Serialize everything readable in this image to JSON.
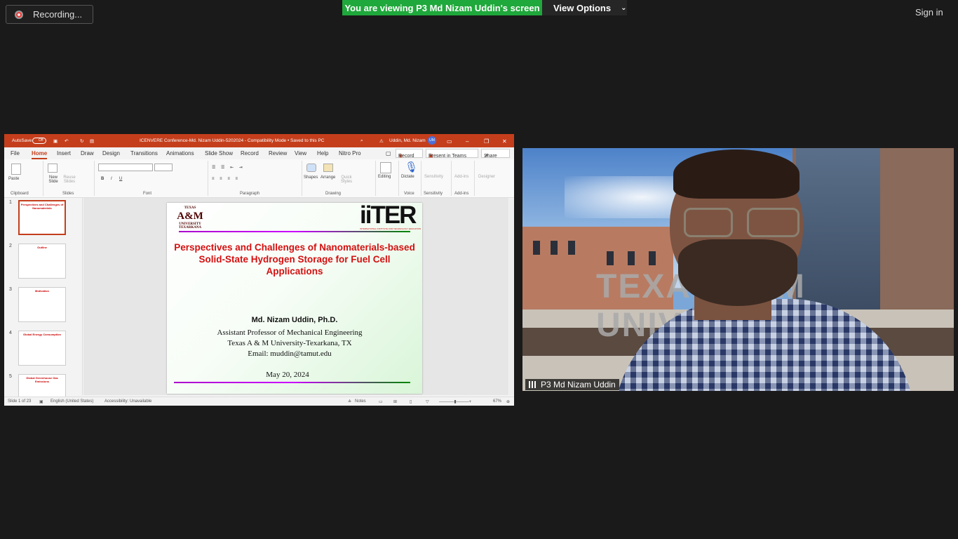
{
  "zoom": {
    "recording_label": "Recording...",
    "viewing_banner": "You are viewing P3 Md Nizam Uddin's screen",
    "view_options": "View Options",
    "sign_in": "Sign in",
    "participant_name": "P3 Md Nizam Uddin",
    "accent_green": "#1fa83b"
  },
  "ppt": {
    "autosave": "AutoSave",
    "autosave_state": "Off",
    "title": "ICENVERE Conference-Md. Nizam Uddin-5202024 - Compatibility Mode • Saved to this PC",
    "user": "Uddin, Md. Nizam",
    "user_initials": "UM",
    "menu": [
      "File",
      "Home",
      "Insert",
      "Draw",
      "Design",
      "Transitions",
      "Animations",
      "Slide Show",
      "Record",
      "Review",
      "View",
      "Help",
      "Nitro Pro"
    ],
    "record_btn": "Record",
    "present_btn": "Present in Teams",
    "share_btn": "Share",
    "ribbon": {
      "paste": "Paste",
      "new_slide": "New Slide",
      "reuse_slides": "Reuse Slides",
      "shapes": "Shapes",
      "arrange": "Arrange",
      "quick_styles": "Quick Styles",
      "editing": "Editing",
      "dictate": "Dictate",
      "sensitivity": "Sensitivity",
      "addins": "Add-ins",
      "designer": "Designer",
      "groups": [
        "Clipboard",
        "Slides",
        "Font",
        "Paragraph",
        "Drawing",
        "Voice",
        "Sensitivity",
        "Add-ins"
      ]
    },
    "thumbs": [
      {
        "num": "1",
        "title": "Perspectives and Challenges of Nanomaterials"
      },
      {
        "num": "2",
        "title": "Outline"
      },
      {
        "num": "3",
        "title": "Motivation"
      },
      {
        "num": "4",
        "title": "Global Energy Consumption"
      },
      {
        "num": "5",
        "title": "Global Greenhouse Gas Emissions"
      }
    ],
    "slide": {
      "tamu_logo_text": "A&M",
      "tamu_top": "TEXAS",
      "tamu_bottom": "UNIVERSITY TEXARKANA",
      "iiter_logo_text": "iiTER",
      "iiter_sub": "INTERNATIONAL INSTITUTE FOR TECHNOLOGY EDUCATION AND RESEARCH",
      "title": "Perspectives and Challenges of Nanomaterials-based Solid-State Hydrogen Storage for Fuel Cell Applications",
      "author": "Md. Nizam Uddin, Ph.D.",
      "affiliation_1": "Assistant Professor of Mechanical Engineering",
      "affiliation_2": "Texas A & M University-Texarkana, TX",
      "affiliation_3": "Email: muddin@tamut.edu",
      "date": "May 20, 2024",
      "title_color": "#d41010"
    },
    "status": {
      "slide_of": "Slide 1 of 23",
      "language": "English (United States)",
      "accessibility": "Accessibility: Unavailable",
      "notes": "Notes",
      "zoom": "67%"
    },
    "accent": "#c43e1c"
  }
}
